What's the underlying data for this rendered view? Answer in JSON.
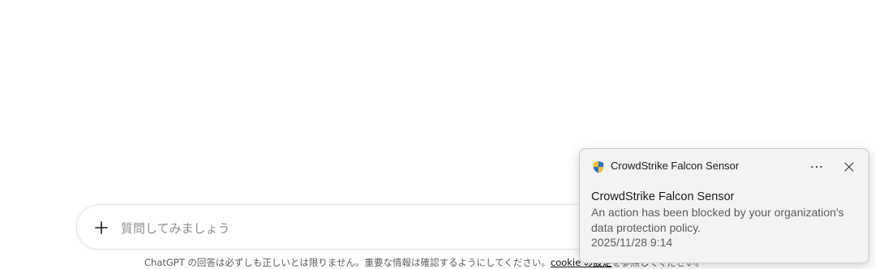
{
  "composer": {
    "placeholder": "質問してみましょう",
    "add_icon": "plus-icon"
  },
  "disclaimer": {
    "text_before": "ChatGPT の回答は必ずしも正しいとは限りません。重要な情報は確認するようにしてください。",
    "link_label": "cookie の設定",
    "text_after": "を参照してください。"
  },
  "notification": {
    "app_name": "CrowdStrike Falcon Sensor",
    "app_icon": "shield-icon",
    "more_icon": "more-options-icon",
    "close_icon": "close-icon",
    "title": "CrowdStrike Falcon Sensor",
    "message": "An action has been blocked by your organization's data protection policy.",
    "timestamp": "2025/11/28 9:14"
  },
  "colors": {
    "shield_blue": "#2b6fd6",
    "shield_yellow": "#f2c21a"
  }
}
